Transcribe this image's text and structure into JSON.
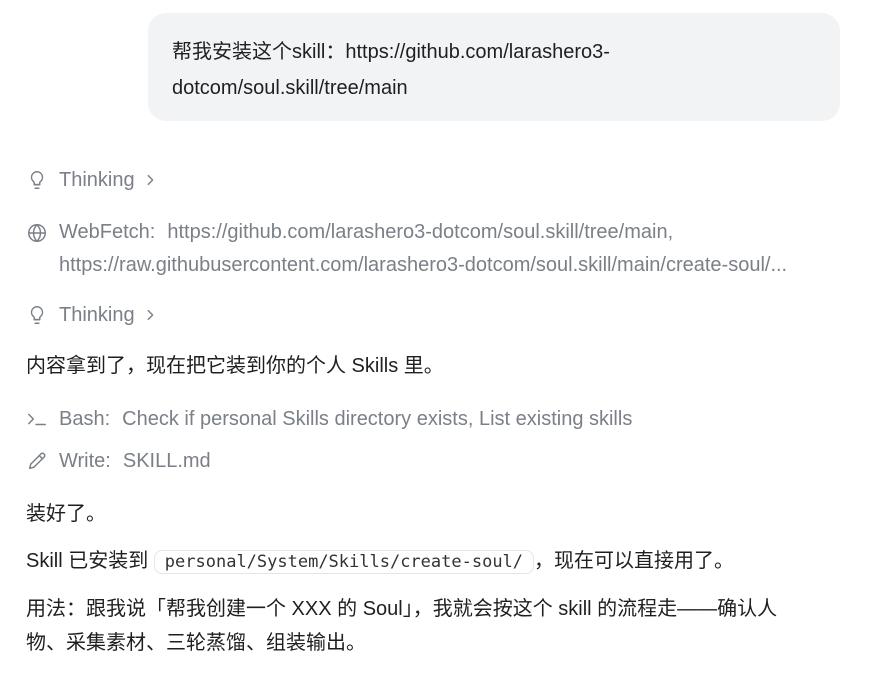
{
  "user_message": {
    "line1": "帮我安装这个skill：https://github.com/larashero3-",
    "line2": "dotcom/soul.skill/tree/main"
  },
  "thinking_1": {
    "label": "Thinking",
    "icon": "lightbulb-icon"
  },
  "webfetch": {
    "label": "WebFetch:",
    "url1": "https://github.com/larashero3-dotcom/soul.skill/tree/main,",
    "url2": "https://raw.githubusercontent.com/larashero3-dotcom/soul.skill/main/create-soul/...",
    "icon": "globe-icon"
  },
  "thinking_2": {
    "label": "Thinking",
    "icon": "lightbulb-icon"
  },
  "reply_1": "内容拿到了，现在把它装到你的个人 Skills 里。",
  "bash": {
    "label": "Bash:",
    "detail": "Check if personal Skills directory exists, List existing skills",
    "icon": "terminal-icon"
  },
  "write": {
    "label": "Write:",
    "detail": "SKILL.md",
    "icon": "pencil-icon"
  },
  "reply_2": "装好了。",
  "reply_3": {
    "before": "Skill 已安装到",
    "code": "personal/System/Skills/create-soul/",
    "after": "，现在可以直接用了。"
  },
  "reply_4": {
    "line1": "用法：跟我说「帮我创建一个 XXX 的 Soul」，我就会按这个 skill 的流程走——确认人",
    "line2": "物、采集素材、三轮蒸馏、组装输出。"
  },
  "colors": {
    "muted": "#7a7f88",
    "text": "#1f1f1f",
    "bubble": "#f2f3f5"
  }
}
